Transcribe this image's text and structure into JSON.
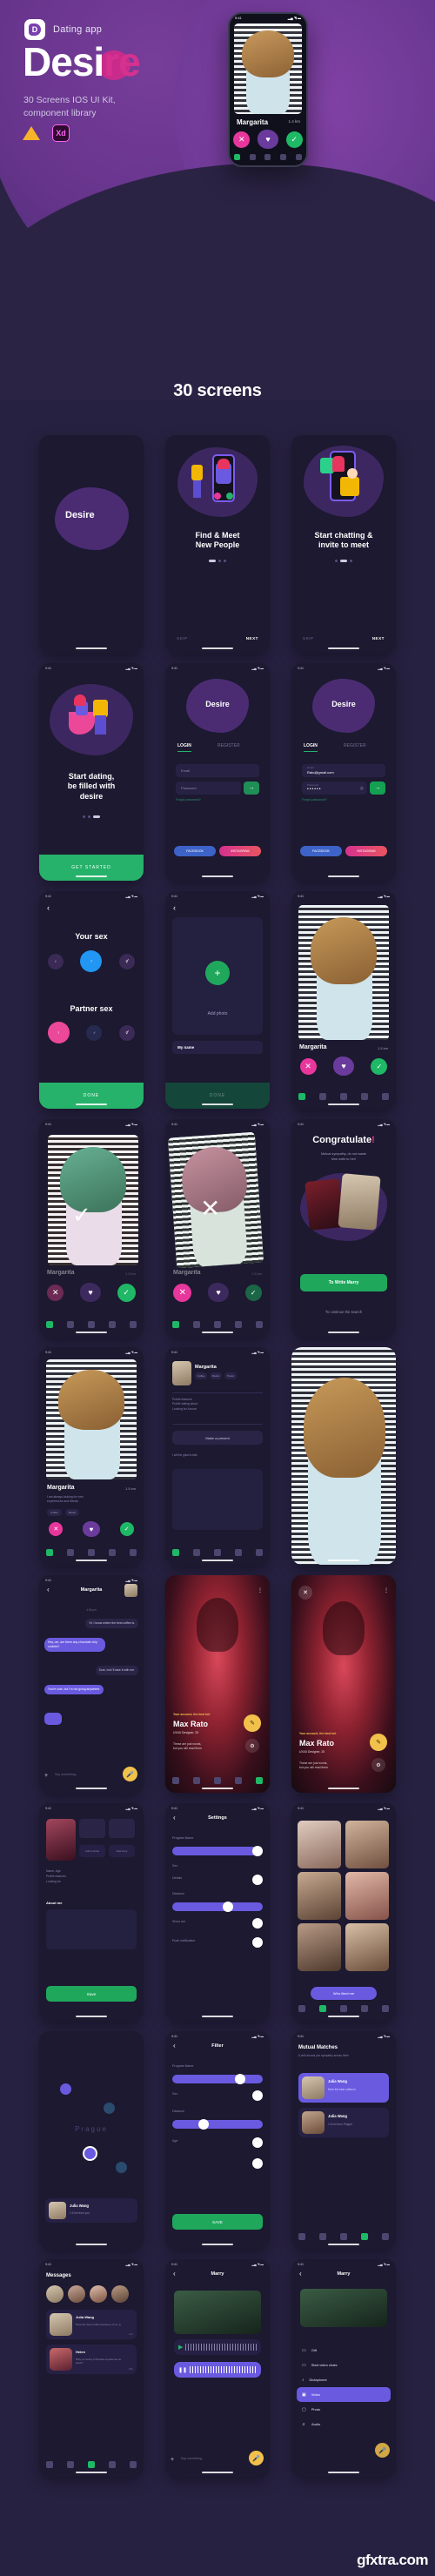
{
  "hero": {
    "app_badge_letter": "D",
    "app_category": "Dating app",
    "title_main": "Desi",
    "title_accent": "re",
    "subtitle": "30 Screens IOS UI Kit,\ncomponent library",
    "badge_sketch": "sketch-icon",
    "badge_xd": "Xd",
    "phone": {
      "status_time": "9:41",
      "status_icons": "signal-wifi-battery",
      "profile_name": "Margarita",
      "distance": "1.4 km",
      "action_dislike": "✕",
      "action_superlike": "♥",
      "action_like": "✓"
    }
  },
  "section": {
    "title": "30 screens"
  },
  "screens": {
    "row1": [
      {
        "name": "splash",
        "logo": "Desire"
      },
      {
        "name": "onboarding-1",
        "title": "Find & Meet\nNew People",
        "skip": "SKIP",
        "next": "NEXT",
        "dot_active": 0
      },
      {
        "name": "onboarding-2",
        "title": "Start chatting &\ninvite to meet",
        "skip": "SKIP",
        "next": "NEXT",
        "dot_active": 1
      }
    ],
    "row2": [
      {
        "name": "onboarding-3",
        "title": "Start dating,\nbe filled with\ndesire",
        "cta": "GET STARTED",
        "dot_active": 2
      },
      {
        "name": "login-empty",
        "logo": "Desire",
        "tab_login": "LOGIN",
        "tab_register": "REGISTER",
        "email_placeholder": "Email",
        "password_placeholder": "Password",
        "forgot": "Forgot password?",
        "facebook": "FACEBOOK",
        "instagram": "INSTAGRAM",
        "submit": "→"
      },
      {
        "name": "login-filled",
        "logo": "Desire",
        "tab_login": "LOGIN",
        "tab_register": "REGISTER",
        "email_label": "Email",
        "email_value": "Rato@gmail.com",
        "password_label": "Password",
        "password_value": "••••••",
        "forgot": "Forgot password?",
        "facebook": "FACEBOOK",
        "instagram": "INSTAGRAM",
        "submit": "→"
      }
    ],
    "row3": [
      {
        "name": "sex-select",
        "your_sex": "Your sex",
        "partner_sex": "Partner sex",
        "opt_female": "Female",
        "opt_male": "Male",
        "opt_other": "Other",
        "cta": "DONE"
      },
      {
        "name": "add-photo",
        "add_photo": "Add photo",
        "my_name": "My name",
        "cta": "DONE"
      },
      {
        "name": "discover",
        "profile_name": "Margarita",
        "distance": "1.5 km"
      }
    ],
    "row4": [
      {
        "name": "swipe-like",
        "profile_name": "Margarita",
        "distance": "1.5 km",
        "overlay": "check"
      },
      {
        "name": "swipe-dislike",
        "profile_name": "Margarita",
        "distance": "1.5 km",
        "overlay": "cross"
      },
      {
        "name": "match",
        "title_main": "Congratulate",
        "title_accent": "!",
        "subtitle": "Mutual sympathy, do not waste\ntime write to her!",
        "cta": "To Write Marry",
        "secondary": "To continue the search"
      }
    ],
    "row5": [
      {
        "name": "profile-card",
        "profile_name": "Margarita",
        "distance": "1.5 km"
      },
      {
        "name": "profile-details",
        "profile_name": "Margarita",
        "cta": "Make a present",
        "tags": [
          "Coffee",
          "Books",
          "Travel"
        ],
        "note": "I will be glad to talk"
      },
      {
        "name": "photo-full"
      }
    ],
    "row6": [
      {
        "name": "chat",
        "profile_name": "Margarita",
        "time": "4:36 pm",
        "messages": [
          {
            "from": "you",
            "text": "Hi, I know where the best coffee is."
          },
          {
            "from": "me",
            "text": "Hey, um, are there any chocolate chip cookies?"
          },
          {
            "from": "you",
            "text": "Sure, but I'll take it with me."
          },
          {
            "from": "me",
            "text": "You're cute, but I'm not going anywhere."
          }
        ],
        "input_placeholder": "Say something..."
      },
      {
        "name": "my-profile",
        "account_note": "Your account, the best bet",
        "profile_name": "Max Rato",
        "profile_sub": "UX/UI Designer, 25",
        "bio": "These are just words,\nbut you will read them"
      },
      {
        "name": "my-profile-edit",
        "account_note": "Your account, the best bet",
        "profile_name": "Max Rato",
        "profile_sub": "UX/UI Designer, 25",
        "bio": "These are just words,\nbut you will read them"
      }
    ],
    "row7": [
      {
        "name": "edit-profile",
        "add_photo": "Add a photo",
        "add_story": "Add story",
        "about_label": "About me",
        "cta": "Save"
      },
      {
        "name": "settings",
        "title": "Settings",
        "items": [
          "Program Name",
          "Sex",
          "Details",
          "Distance",
          "Show me",
          "Push notification"
        ]
      },
      {
        "name": "people-grid",
        "cta": "Who liked me"
      }
    ],
    "row8": [
      {
        "name": "map",
        "city": "Prague",
        "profile_name": "Julia Wang",
        "profile_sub": "1.5 km from you"
      },
      {
        "name": "filter",
        "title": "Filter",
        "items": [
          "Program Name",
          "Sex",
          "Distance",
          "Age"
        ],
        "cta": "SAVE"
      },
      {
        "name": "mutual-matches",
        "title": "Mutual Matches",
        "subtitle": "A chill around you sympathy across them",
        "items": [
          {
            "name": "Julia Wang",
            "text": "Here the best coffee is"
          },
          {
            "name": "Julia Wang",
            "text": "1.5 km from Prague"
          }
        ]
      }
    ],
    "row9": [
      {
        "name": "messages-list",
        "title": "Messages",
        "items": [
          {
            "name": "Julia Wang",
            "text": "Here the best coffee because of us :))",
            "time": "12m"
          },
          {
            "name": "Helen",
            "text": "Why so lonely in Russia experience to clear?",
            "time": "25m"
          }
        ]
      },
      {
        "name": "voice-chat",
        "title": "Marry",
        "input_placeholder": "Say something..."
      },
      {
        "name": "attach-menu",
        "title": "Marry",
        "items": [
          "Gift",
          "Start video chats",
          "Dictaphone",
          "Video",
          "Photo",
          "Audio"
        ],
        "highlighted": "Video"
      }
    ]
  },
  "watermark": "gfxtra.com",
  "colors": {
    "bg": "#272141",
    "card": "#1c1930",
    "accent_pink": "#d6318f",
    "accent_purple": "#6a3b9c",
    "accent_green": "#26b26a",
    "accent_yellow": "#f2c14b",
    "accent_violet": "#6a5ae0"
  }
}
